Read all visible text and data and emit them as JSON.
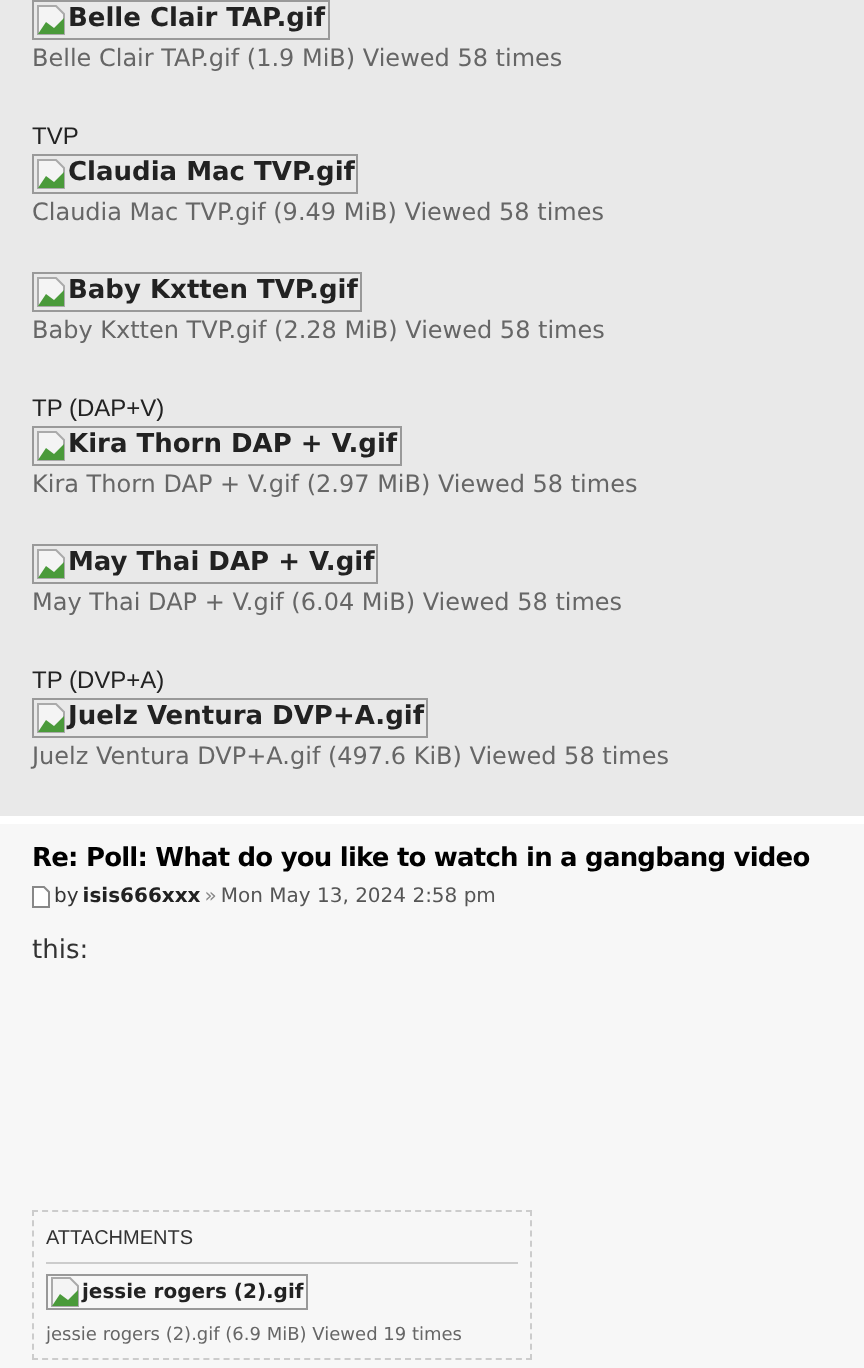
{
  "attachments": [
    {
      "image_alt": "Belle Clair TAP.gif",
      "caption": "Belle Clair TAP.gif (1.9 MiB) Viewed 58 times"
    },
    {
      "label": "TVP",
      "image_alt": "Claudia Mac TVP.gif",
      "caption": "Claudia Mac TVP.gif (9.49 MiB) Viewed 58 times"
    },
    {
      "image_alt": "Baby Kxtten TVP.gif",
      "caption": "Baby Kxtten TVP.gif (2.28 MiB) Viewed 58 times"
    },
    {
      "label": "TP (DAP+V)",
      "image_alt": "Kira Thorn DAP + V.gif",
      "caption": "Kira Thorn DAP + V.gif (2.97 MiB) Viewed 58 times"
    },
    {
      "image_alt": "May Thai DAP + V.gif",
      "caption": "May Thai DAP + V.gif (6.04 MiB) Viewed 58 times"
    },
    {
      "label": "TP (DVP+A)",
      "image_alt": "Juelz Ventura DVP+A.gif",
      "caption": "Juelz Ventura DVP+A.gif (497.6 KiB) Viewed 58 times"
    }
  ],
  "post": {
    "title": "Re: Poll: What do you like to watch in a gangbang video",
    "by": "by",
    "author": "isis666xxx",
    "sep": "»",
    "date": "Mon May 13, 2024 2:58 pm",
    "body": "this:",
    "attachments_box": {
      "heading": "ATTACHMENTS",
      "image_alt": "jessie rogers (2).gif",
      "caption": "jessie rogers (2).gif (6.9 MiB) Viewed 19 times"
    }
  }
}
